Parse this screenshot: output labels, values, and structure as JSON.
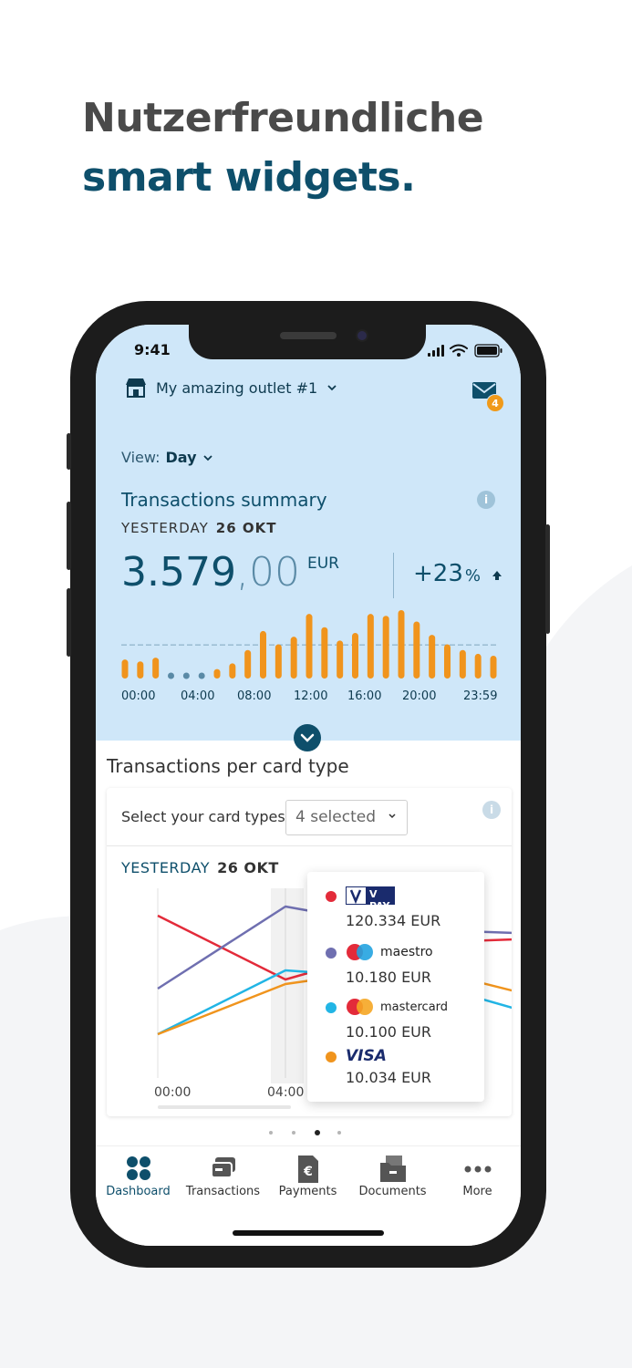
{
  "headline": {
    "line1": "Nutzerfreundliche",
    "line2": "smart widgets."
  },
  "status": {
    "time": "9:41"
  },
  "header": {
    "outlet_name": "My amazing outlet #1",
    "mail_badge": "4"
  },
  "view": {
    "label": "View:",
    "value": "Day"
  },
  "summary": {
    "title": "Transactions summary",
    "date_prefix": "YESTERDAY",
    "date": "26 OKT",
    "amount_int": "3.579",
    "amount_dec": ",00",
    "currency": "EUR",
    "change": "+23",
    "change_unit": "%",
    "info_icon": "i"
  },
  "chart_data": [
    {
      "type": "bar",
      "categories": [
        "00:00",
        "01:00",
        "02:00",
        "03:00",
        "04:00",
        "05:00",
        "06:00",
        "07:00",
        "08:00",
        "09:00",
        "10:00",
        "11:00",
        "12:00",
        "13:00",
        "14:00",
        "15:00",
        "16:00",
        "17:00",
        "18:00",
        "19:00",
        "20:00",
        "21:00",
        "22:00",
        "23:00",
        "23:59"
      ],
      "values": [
        10,
        9,
        11,
        0,
        0,
        0,
        5,
        8,
        15,
        25,
        18,
        22,
        34,
        27,
        20,
        24,
        34,
        33,
        36,
        30,
        23,
        18,
        15,
        13,
        12
      ],
      "xticks": [
        "00:00",
        "04:00",
        "08:00",
        "12:00",
        "16:00",
        "20:00",
        "23:59"
      ],
      "average_line": true,
      "color": "#f0941d",
      "zero_color": "#5a8aa6"
    },
    {
      "type": "line",
      "x": [
        "00:00",
        "04:00",
        "08:00",
        "12:00"
      ],
      "xticks": [
        "00:00",
        "04:00"
      ],
      "series": [
        {
          "color": "#e32b3a",
          "values": [
            150,
            80,
            120,
            125
          ]
        },
        {
          "color": "#6f6fb0",
          "values": [
            70,
            160,
            135,
            130
          ]
        },
        {
          "color": "#22b5e5",
          "values": [
            20,
            90,
            80,
            40
          ]
        },
        {
          "color": "#f0941d",
          "values": [
            20,
            75,
            95,
            60
          ]
        }
      ],
      "ylim": [
        0,
        180
      ]
    }
  ],
  "card_types": {
    "section_title": "Transactions per card type",
    "select_label": "Select your card types",
    "select_value": "4 selected",
    "date_prefix": "YESTERDAY",
    "date": "26 OKT",
    "info_icon": "i",
    "tooltip": [
      {
        "brand": "V PAY",
        "value": "120.334 EUR",
        "color": "#e32b3a"
      },
      {
        "brand": "maestro",
        "value": "10.180 EUR",
        "color": "#6f6fb0"
      },
      {
        "brand": "mastercard",
        "value": "10.100 EUR",
        "color": "#22b5e5"
      },
      {
        "brand": "VISA",
        "value": "10.034 EUR",
        "color": "#f0941d"
      }
    ]
  },
  "pager": {
    "count": 4,
    "active": 2
  },
  "tabs": [
    {
      "label": "Dashboard",
      "icon": "dashboard-icon",
      "active": true
    },
    {
      "label": "Transactions",
      "icon": "transactions-icon",
      "active": false
    },
    {
      "label": "Payments",
      "icon": "payments-icon",
      "active": false
    },
    {
      "label": "Documents",
      "icon": "documents-icon",
      "active": false
    },
    {
      "label": "More",
      "icon": "more-icon",
      "active": false
    }
  ],
  "colors": {
    "accent": "#0e4f6b",
    "header_bg": "#cfe7f9",
    "orange": "#f0941d"
  }
}
